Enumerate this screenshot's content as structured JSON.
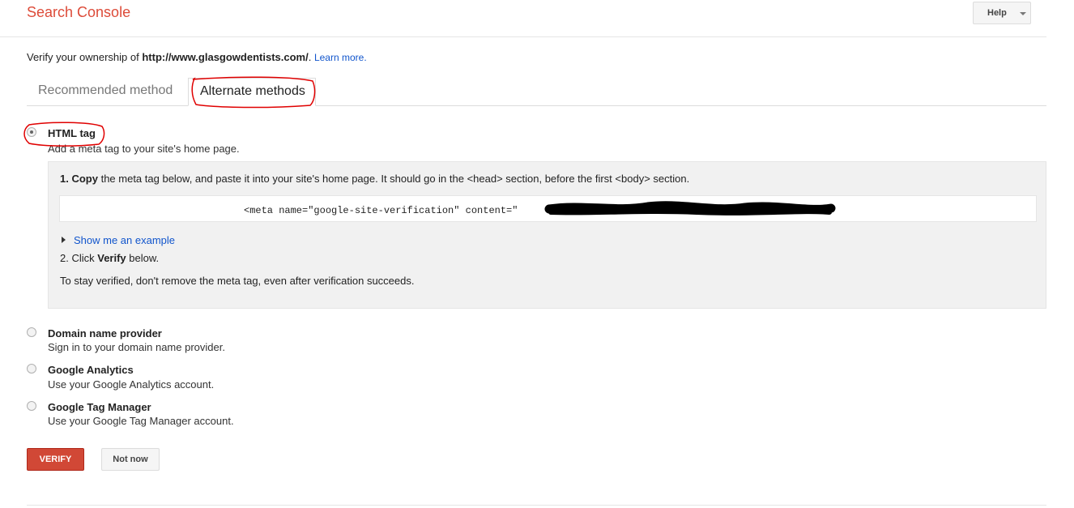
{
  "header": {
    "app_title": "Search Console",
    "help_label": "Help",
    "help_icon": "chevron-down-icon"
  },
  "verification": {
    "prefix": "Verify your ownership of ",
    "site_url": "http://www.glasgowdentists.com/",
    "suffix": ". ",
    "learn_more": "Learn more."
  },
  "tabs": [
    {
      "label": "Recommended method",
      "selected": false
    },
    {
      "label": "Alternate methods",
      "selected": true
    }
  ],
  "methods": {
    "html_tag": {
      "title": "HTML tag",
      "description": "Add a meta tag to your site's home page.",
      "selected": true,
      "step1_number": "1.",
      "step1_bold": "Copy",
      "step1_text": " the meta tag below, and paste it into your site's home page. It should go in the <head> section, before the first <body> section.",
      "code_prefix": "<meta name=\"google-site-verification\" content=\"",
      "code_suffix": "\" />",
      "show_example": "Show me an example",
      "step2_prefix": "2. Click ",
      "step2_bold": "Verify",
      "step2_suffix": " below.",
      "stay_verified": "To stay verified, don't remove the meta tag, even after verification succeeds."
    },
    "others": [
      {
        "title": "Domain name provider",
        "description": "Sign in to your domain name provider."
      },
      {
        "title": "Google Analytics",
        "description": "Use your Google Analytics account."
      },
      {
        "title": "Google Tag Manager",
        "description": "Use your Google Tag Manager account."
      }
    ]
  },
  "actions": {
    "verify": "VERIFY",
    "not_now": "Not now"
  },
  "colors": {
    "brand": "#dd4b39",
    "link": "#1155cc",
    "verify_button": "#d14836",
    "annotation": "#e00000"
  }
}
